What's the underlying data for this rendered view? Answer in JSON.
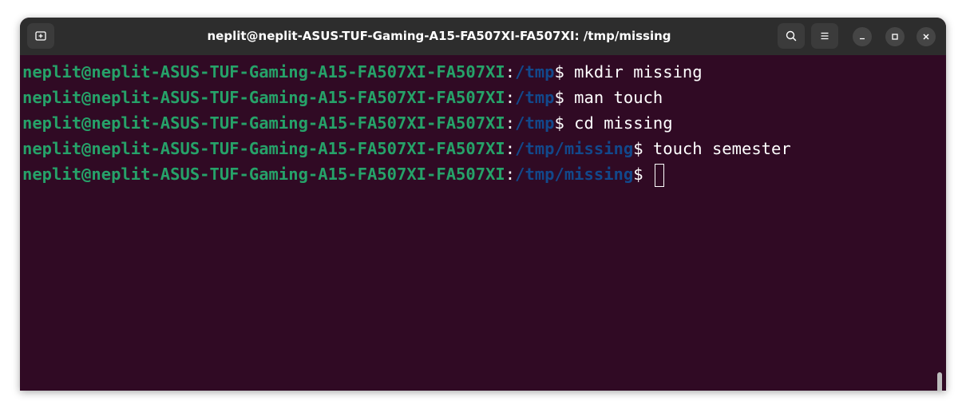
{
  "window": {
    "title": "neplit@neplit-ASUS-TUF-Gaming-A15-FA507XI-FA507XI: /tmp/missing"
  },
  "titlebar_buttons": {
    "new_tab_icon": "new-tab-icon",
    "search_icon": "search-icon",
    "menu_icon": "hamburger-menu-icon",
    "minimize_icon": "minimize-icon",
    "maximize_icon": "maximize-icon",
    "close_icon": "close-icon"
  },
  "terminal": {
    "lines": [
      {
        "user": "neplit@neplit-ASUS-TUF-Gaming-A15-FA507XI-FA507XI",
        "colon": ":",
        "path": "/tmp",
        "prompt": "$ ",
        "command": "mkdir missing"
      },
      {
        "user": "neplit@neplit-ASUS-TUF-Gaming-A15-FA507XI-FA507XI",
        "colon": ":",
        "path": "/tmp",
        "prompt": "$ ",
        "command": "man touch"
      },
      {
        "user": "neplit@neplit-ASUS-TUF-Gaming-A15-FA507XI-FA507XI",
        "colon": ":",
        "path": "/tmp",
        "prompt": "$ ",
        "command": "cd missing"
      },
      {
        "user": "neplit@neplit-ASUS-TUF-Gaming-A15-FA507XI-FA507XI",
        "colon": ":",
        "path": "/tmp/missing",
        "prompt": "$ ",
        "command": "touch semester"
      },
      {
        "user": "neplit@neplit-ASUS-TUF-Gaming-A15-FA507XI-FA507XI",
        "colon": ":",
        "path": "/tmp/missing",
        "prompt": "$ ",
        "command": ""
      }
    ]
  },
  "colors": {
    "background": "#300a24",
    "titlebar": "#2d2d2d",
    "user_host": "#26a269",
    "path": "#12488b",
    "text": "#ffffff"
  }
}
